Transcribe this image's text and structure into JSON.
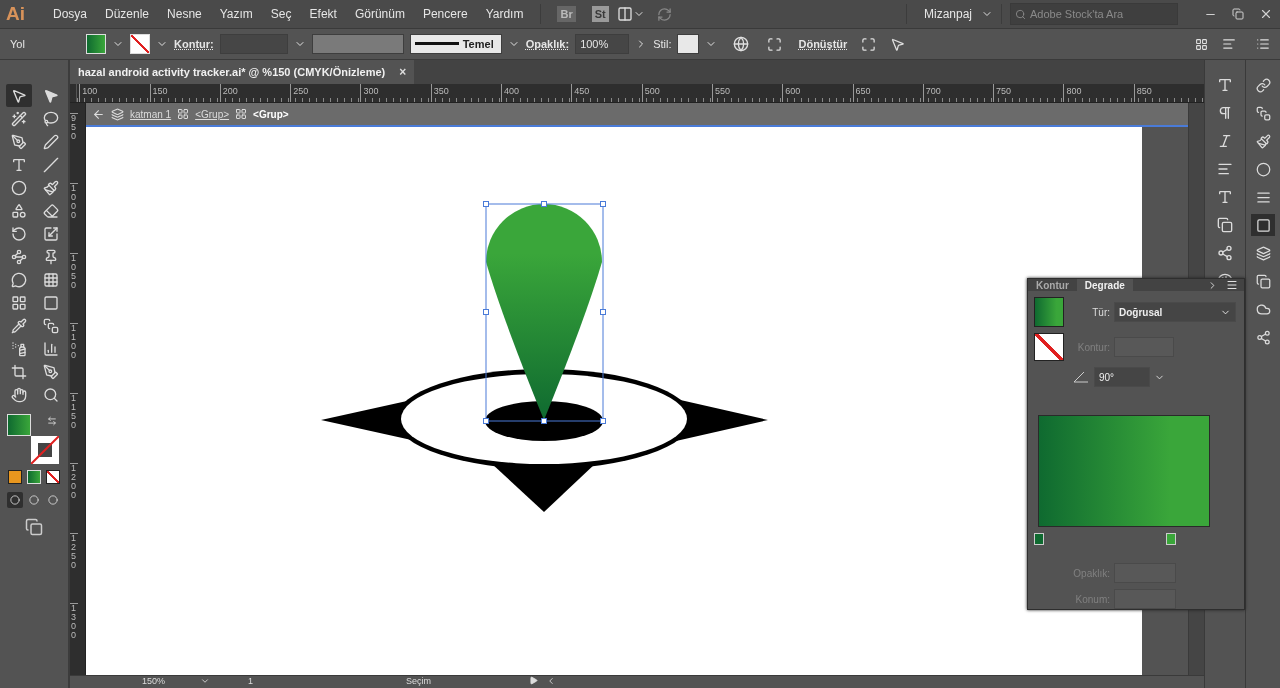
{
  "menu_bar": {
    "logo": "Ai",
    "menus": [
      "Dosya",
      "Düzenle",
      "Nesne",
      "Yazım",
      "Seç",
      "Efekt",
      "Görünüm",
      "Pencere",
      "Yardım"
    ],
    "bridge": "Br",
    "stock": "St",
    "workspace": "Mizanpaj",
    "search": {
      "placeholder": "Adobe Stock'ta Ara"
    }
  },
  "control_bar": {
    "object": "Yol",
    "stroke_label": "Kontur:",
    "brush": "Temel",
    "opacity_label": "Opaklık:",
    "opacity": "100%",
    "style_label": "Stil:",
    "transform": "Dönüştür"
  },
  "document": {
    "tab_title": "hazal android activity tracker.ai* @ %150 (CMYK/Önizleme)",
    "close": "×",
    "breadcrumb": [
      "katman 1",
      "<Grup>",
      "<Grup>"
    ],
    "h_ruler": [
      "100",
      "150",
      "200",
      "250",
      "300",
      "350",
      "400",
      "450",
      "500",
      "550",
      "600",
      "650",
      "700",
      "750",
      "800",
      "850"
    ],
    "v_ruler": [
      "950",
      "1000",
      "1050",
      "1100",
      "1150",
      "1200",
      "1250",
      "1300"
    ]
  },
  "toolbar": {
    "tools": [
      {
        "selected": true
      },
      {
        "selected": false
      },
      {
        "selected": false
      },
      {
        "selected": false
      },
      {
        "selected": false
      },
      {
        "selected": false
      },
      {
        "selected": false
      },
      {
        "selected": false
      },
      {
        "selected": false
      },
      {
        "selected": false
      },
      {
        "selected": false
      },
      {
        "selected": false
      },
      {
        "selected": false
      },
      {
        "selected": false
      },
      {
        "selected": false
      },
      {
        "selected": false
      },
      {
        "selected": false
      },
      {
        "selected": false
      },
      {
        "selected": false
      },
      {
        "selected": false
      },
      {
        "selected": false
      },
      {
        "selected": false
      },
      {
        "selected": false
      },
      {
        "selected": false
      },
      {
        "selected": false
      },
      {
        "selected": false
      }
    ],
    "draw_modes": [
      {
        "selected": true
      },
      {
        "selected": false
      },
      {
        "selected": false
      }
    ]
  },
  "gradient_panel": {
    "tabs": [
      {
        "label": "Kontur",
        "selected": false
      },
      {
        "label": "Degrade",
        "selected": true
      }
    ],
    "type_label": "Tür:",
    "type": "Doğrusal",
    "stroke_label": "Kontur:",
    "angle": "90°",
    "opacity_label": "Opaklık:",
    "location_label": "Konum:",
    "stops": [
      {
        "color": "#0f6a30"
      },
      {
        "color": "#3aa63a"
      }
    ]
  },
  "status_bar": {
    "zoom": "150%",
    "page": "1",
    "tool": "Seçim"
  }
}
